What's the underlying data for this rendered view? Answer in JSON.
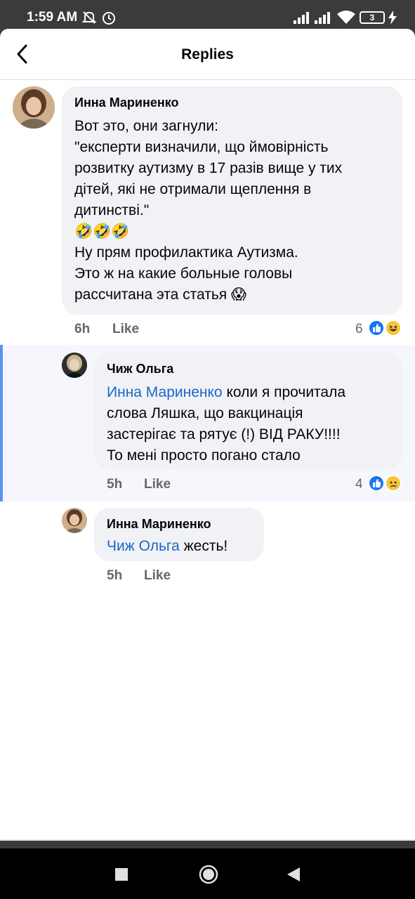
{
  "status_bar": {
    "time": "1:59 AM",
    "battery_level": "3",
    "icons": [
      "mute-icon",
      "alarm-icon",
      "signal-icon",
      "wifi-icon",
      "battery-icon",
      "charging-icon"
    ]
  },
  "header": {
    "title": "Replies",
    "back_icon": "chevron-left-icon"
  },
  "comments": [
    {
      "author": "Инна Мариненко",
      "lines": [
        "Вот это, они загнули:",
        "\"експерти визначили, що ймовірність",
        "розвитку аутизму в 17 разів вище у тих",
        "дітей, які не отримали щеплення в",
        "дитинстві.\"",
        "🤣🤣🤣",
        "Ну прям профилактика Аутизма.",
        "Это ж на какие больные головы",
        "рассчитана эта статья 😱"
      ],
      "time": "6h",
      "like_label": "Like",
      "reaction_count": "6",
      "reactions": [
        "like-icon",
        "haha-icon"
      ]
    },
    {
      "author": "Чиж Ольга",
      "mention": "Инна Мариненко",
      "lines": [
        " коли я прочитала",
        "слова Ляшка, що вакцинація",
        "застерігає та рятує (!) ВІД РАКУ!!!!",
        "То мені просто погано стало"
      ],
      "time": "5h",
      "like_label": "Like",
      "reaction_count": "4",
      "reactions": [
        "like-icon",
        "sad-icon"
      ]
    },
    {
      "author": "Инна Мариненко",
      "mention": "Чиж Ольга",
      "lines": [
        " жесть!"
      ],
      "time": "5h",
      "like_label": "Like"
    }
  ],
  "nav_bar": {
    "buttons": [
      "recents-icon",
      "home-icon",
      "back-triangle-icon"
    ]
  }
}
